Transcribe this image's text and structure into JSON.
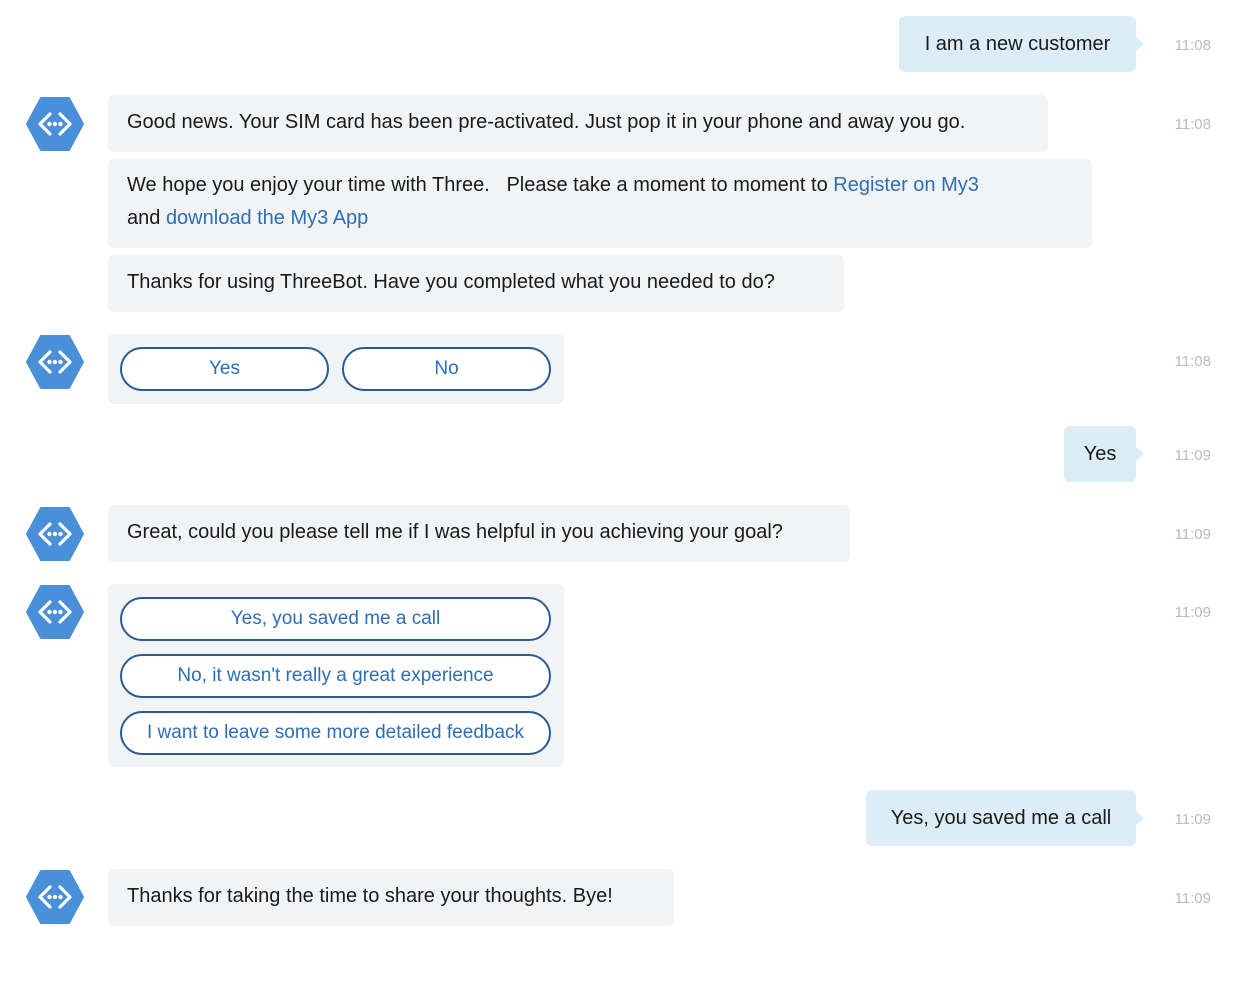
{
  "conversation": {
    "msg1": {
      "text": "I am a new customer",
      "time": "11:08"
    },
    "msg2": {
      "text": "Good news. Your SIM card has been pre-activated. Just pop it in your phone and away you go.",
      "time": "11:08"
    },
    "msg3": {
      "text_before": "We hope you enjoy your time with Three.   Please take a moment to moment to ",
      "link1": "Register on My3",
      "text_mid": "and ",
      "link2": "download the My3 App"
    },
    "msg4": {
      "text": "Thanks for using ThreeBot. Have you completed what you needed to do?"
    },
    "quick1": {
      "yes": "Yes",
      "no": "No",
      "time": "11:08"
    },
    "msg5": {
      "text": "Yes",
      "time": "11:09"
    },
    "msg6": {
      "text": "Great, could you please tell me if I was helpful in you achieving your goal?",
      "time": "11:09"
    },
    "quick2": {
      "opt1": "Yes, you saved me a call",
      "opt2": "No, it wasn't really a great experience",
      "opt3": "I want to leave some more detailed feedback",
      "time": "11:09"
    },
    "msg7": {
      "text": "Yes, you saved me a call",
      "time": "11:09"
    },
    "msg8": {
      "text": "Thanks for taking the time to share your thoughts. Bye!",
      "time": "11:09"
    }
  },
  "colors": {
    "bot_avatar": "#4a90d9",
    "user_bubble": "#ddedf7",
    "bot_bubble": "#f1f3f5",
    "link": "#2e6eb5",
    "button_border": "#2b5a93",
    "timestamp": "#b6bcc2"
  },
  "icons": {
    "bot_avatar": "code-hexagon-icon"
  }
}
